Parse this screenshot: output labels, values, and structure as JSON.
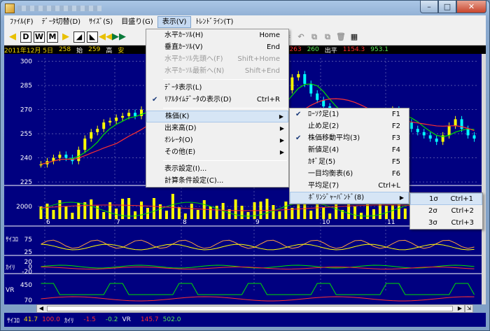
{
  "menubar": [
    {
      "label": "ﾌｧｲﾙ(F)",
      "active": false
    },
    {
      "label": "ﾃﾞｰﾀ切替(D)",
      "active": false
    },
    {
      "label": "ｻｲｽﾞ(S)",
      "active": false
    },
    {
      "label": "目盛り(G)",
      "active": false
    },
    {
      "label": "表示(V)",
      "active": true
    },
    {
      "label": "ﾄﾚﾝﾄﾞﾗｲﾝ(T)",
      "active": false
    }
  ],
  "toolbar": {
    "d_label": "D",
    "w_label": "W",
    "m_label": "M"
  },
  "infobar": {
    "date": "2011年12月 5日",
    "open_label": "始",
    "open": "258",
    "high_label": "高",
    "high": "259",
    "low_label": "安",
    "v1": "263",
    "v2": "260",
    "volume_label": "出平",
    "v3": "1154.3",
    "v4": "953.1"
  },
  "chart_data": {
    "type": "candlestick",
    "price_ticks": [
      "300",
      "285",
      "270",
      "255",
      "240",
      "225"
    ],
    "ylim": [
      222,
      302
    ],
    "volume_tick": "2000",
    "date_ticks": [
      "6",
      "7",
      "8",
      "9",
      "10",
      "11"
    ],
    "sub_labels": [
      "ｻｲｺﾛ",
      "ｶｲﾘ",
      "VR"
    ],
    "psy_ticks": [
      "75",
      "25"
    ],
    "kairi_ticks": [
      "20",
      "0",
      "-20"
    ],
    "vr_ticks": [
      "450",
      "70"
    ],
    "close": [
      236,
      238,
      240,
      242,
      240,
      238,
      245,
      252,
      256,
      258,
      262,
      263,
      265,
      266,
      268,
      266,
      270,
      272,
      271,
      268,
      266,
      268,
      267,
      264,
      262,
      260,
      258,
      256,
      254,
      252,
      250,
      252,
      255,
      258,
      262,
      266,
      270,
      274,
      278,
      282,
      290,
      292,
      286,
      280,
      276,
      272,
      268,
      264,
      262,
      260,
      258,
      256,
      258,
      262,
      266,
      268,
      270,
      266,
      262,
      258,
      256,
      254,
      252,
      250,
      254,
      260,
      264,
      258,
      254,
      252
    ]
  },
  "status": {
    "psy_label": "ｻｲｺﾛ",
    "psy1": "41.7",
    "psy2": "100.0",
    "kairi_label": "ｶｲﾘ",
    "kairi1": "-1.5",
    "kairi2": "-0.2",
    "vr_label": "VR",
    "vr1": "145.7",
    "vr2": "502.0"
  },
  "view_menu": {
    "items": [
      {
        "label": "水平ｶｰｿﾙ(H)",
        "shortcut": "Home",
        "disabled": false,
        "checked": false,
        "submenu": false
      },
      {
        "label": "垂直ｶｰｿﾙ(V)",
        "shortcut": "End",
        "disabled": false,
        "checked": false,
        "submenu": false
      },
      {
        "label": "水平ｶｰｿﾙ先頭へ(F)",
        "shortcut": "Shift+Home",
        "disabled": true,
        "checked": false,
        "submenu": false
      },
      {
        "label": "水平ｶｰｿﾙ最新へ(N)",
        "shortcut": "Shift+End",
        "disabled": true,
        "checked": false,
        "submenu": false
      },
      {
        "sep": true
      },
      {
        "label": "ﾃﾞｰﾀ表示(L)",
        "shortcut": "",
        "disabled": false,
        "checked": false,
        "submenu": false
      },
      {
        "label": "ﾘｱﾙﾀｲﾑﾃﾞｰﾀの表示(D)",
        "shortcut": "Ctrl+R",
        "disabled": false,
        "checked": true,
        "submenu": false
      },
      {
        "sep": true
      },
      {
        "label": "株価(K)",
        "shortcut": "",
        "disabled": false,
        "checked": false,
        "submenu": true,
        "highlight": true
      },
      {
        "label": "出来高(D)",
        "shortcut": "",
        "disabled": false,
        "checked": false,
        "submenu": true
      },
      {
        "label": "ｵｼﾚｰﾀ(O)",
        "shortcut": "",
        "disabled": false,
        "checked": false,
        "submenu": true
      },
      {
        "label": "その他(E)",
        "shortcut": "",
        "disabled": false,
        "checked": false,
        "submenu": true
      },
      {
        "sep": true
      },
      {
        "label": "表示設定(I)...",
        "shortcut": "",
        "disabled": false,
        "checked": false,
        "submenu": false
      },
      {
        "label": "計算条件設定(C)...",
        "shortcut": "",
        "disabled": false,
        "checked": false,
        "submenu": false
      }
    ]
  },
  "price_menu": {
    "items": [
      {
        "label": "ﾛｰｿｸ足(1)",
        "shortcut": "F1",
        "checked": true
      },
      {
        "label": "止め足(2)",
        "shortcut": "F2",
        "checked": false
      },
      {
        "label": "株価移動平均(3)",
        "shortcut": "F3",
        "checked": true
      },
      {
        "label": "新値足(4)",
        "shortcut": "F4",
        "checked": false
      },
      {
        "label": "ｶｷﾞ足(5)",
        "shortcut": "F5",
        "checked": false
      },
      {
        "label": "一目均衡表(6)",
        "shortcut": "F6",
        "checked": false
      },
      {
        "label": "平均足(7)",
        "shortcut": "Ctrl+L",
        "checked": false
      },
      {
        "label": "ﾎﾞﾘﾝｼﾞｬｰﾊﾞﾝﾄﾞ(8)",
        "shortcut": "",
        "checked": false,
        "submenu": true,
        "highlight": true
      }
    ]
  },
  "bb_menu": {
    "items": [
      {
        "label": "1σ",
        "shortcut": "Ctrl+1",
        "highlight": true
      },
      {
        "label": "2σ",
        "shortcut": "Ctrl+2"
      },
      {
        "label": "3σ",
        "shortcut": "Ctrl+3"
      }
    ]
  }
}
